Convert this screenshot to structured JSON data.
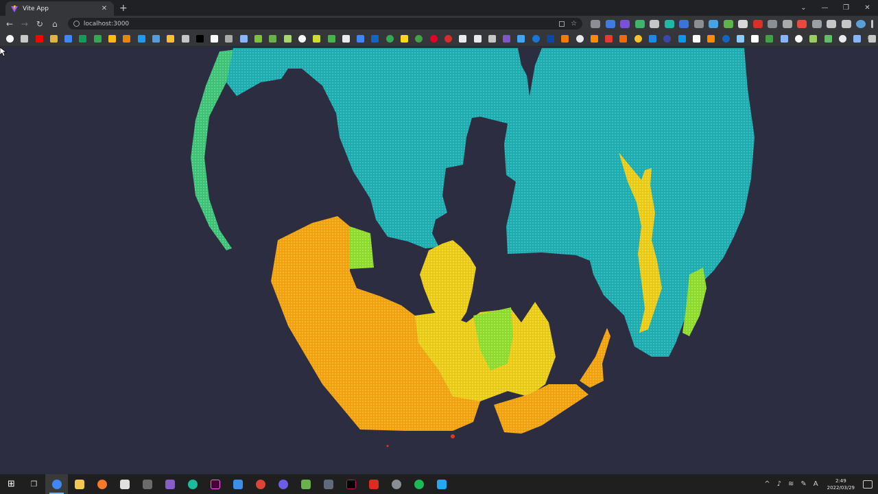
{
  "browser": {
    "tab_title": "Vite App",
    "tab_close": "✕",
    "new_tab": "+",
    "url": "localhost:3000",
    "nav": {
      "back": "←",
      "forward": "→",
      "reload": "↻",
      "home": "⌂"
    },
    "window_controls": {
      "tab_search": "⌄",
      "minimize": "—",
      "maximize": "❐",
      "close": "✕"
    },
    "star": "☆",
    "bookmarks_more": "»"
  },
  "colors": {
    "background": "#2d2d42",
    "cyan": "#26b8b8",
    "green": "#58d56a",
    "lime": "#9ee830",
    "yellow": "#f0d820",
    "orange": "#f3a312",
    "red": "#e03a1a"
  },
  "taskbar": {
    "start": "⊞",
    "task_view": "❐",
    "time": "2:49",
    "date": "2022/03/29",
    "ime": "A",
    "tray_up": "^"
  }
}
